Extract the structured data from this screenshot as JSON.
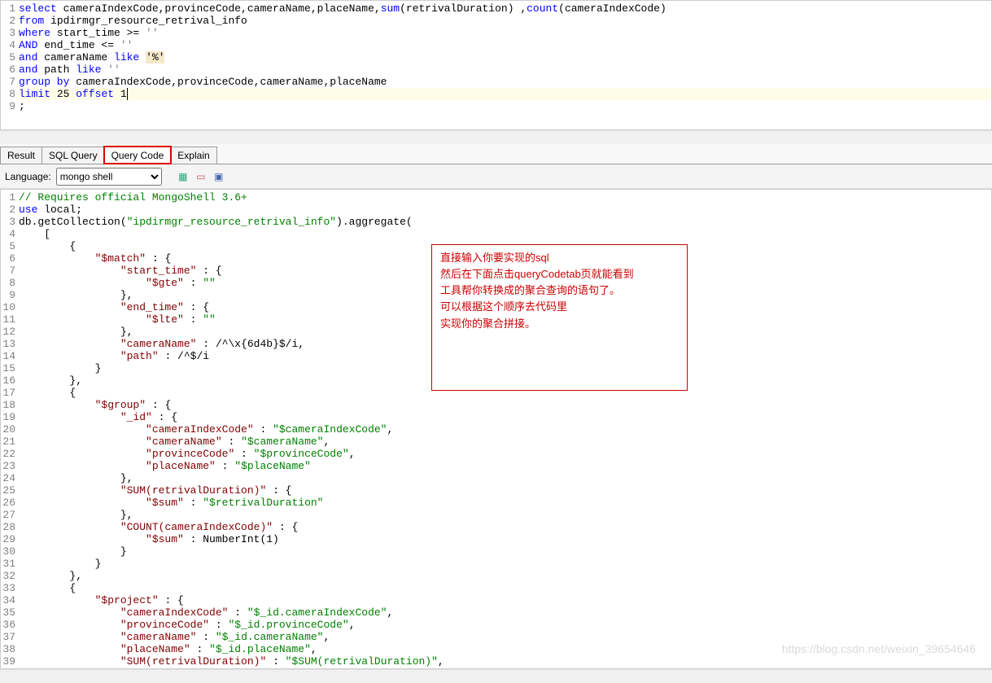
{
  "sql": {
    "lines": [
      {
        "n": 1,
        "h": false,
        "segs": [
          {
            "c": "kw",
            "t": "select"
          },
          {
            "c": "ident",
            "t": " cameraIndexCode,provinceCode,cameraName,placeName,"
          },
          {
            "c": "kw",
            "t": "sum"
          },
          {
            "c": "ident",
            "t": "(retrivalDuration) ,"
          },
          {
            "c": "kw",
            "t": "count"
          },
          {
            "c": "ident",
            "t": "(cameraIndexCode)"
          }
        ]
      },
      {
        "n": 2,
        "h": false,
        "segs": [
          {
            "c": "kw",
            "t": "from"
          },
          {
            "c": "ident",
            "t": " ipdirmgr_resource_retrival_info"
          }
        ]
      },
      {
        "n": 3,
        "h": false,
        "segs": [
          {
            "c": "kw",
            "t": "where"
          },
          {
            "c": "ident",
            "t": " start_time >= "
          },
          {
            "c": "str",
            "t": "''"
          }
        ]
      },
      {
        "n": 4,
        "h": false,
        "segs": [
          {
            "c": "kw",
            "t": "AND"
          },
          {
            "c": "ident",
            "t": " end_time <= "
          },
          {
            "c": "str",
            "t": "''"
          }
        ]
      },
      {
        "n": 5,
        "h": false,
        "segs": [
          {
            "c": "kw",
            "t": "and"
          },
          {
            "c": "ident",
            "t": " cameraName "
          },
          {
            "c": "kw",
            "t": "like"
          },
          {
            "c": "ident",
            "t": " "
          },
          {
            "c": "hstr",
            "t": "'%'"
          }
        ]
      },
      {
        "n": 6,
        "h": false,
        "segs": [
          {
            "c": "kw",
            "t": "and"
          },
          {
            "c": "ident",
            "t": " path "
          },
          {
            "c": "kw",
            "t": "like"
          },
          {
            "c": "ident",
            "t": " "
          },
          {
            "c": "str",
            "t": "''"
          }
        ]
      },
      {
        "n": 7,
        "h": false,
        "segs": [
          {
            "c": "kw",
            "t": "group by"
          },
          {
            "c": "ident",
            "t": " cameraIndexCode,provinceCode,cameraName,placeName"
          }
        ]
      },
      {
        "n": 8,
        "h": true,
        "segs": [
          {
            "c": "kw",
            "t": "limit"
          },
          {
            "c": "ident",
            "t": " 25 "
          },
          {
            "c": "kw",
            "t": "offset"
          },
          {
            "c": "ident",
            "t": " 1"
          },
          {
            "c": "cursor",
            "t": ""
          }
        ]
      },
      {
        "n": 9,
        "h": false,
        "segs": [
          {
            "c": "ident",
            "t": ";"
          }
        ]
      }
    ]
  },
  "tabs": [
    {
      "id": "result",
      "label": "Result",
      "active": false
    },
    {
      "id": "sqlquery",
      "label": "SQL Query",
      "active": false
    },
    {
      "id": "querycode",
      "label": "Query Code",
      "active": true
    },
    {
      "id": "explain",
      "label": "Explain",
      "active": false
    }
  ],
  "toolbar": {
    "language_label": "Language:",
    "language_value": "mongo shell",
    "icons": [
      "sheet",
      "grid",
      "blocks"
    ]
  },
  "mongo": {
    "lines": [
      {
        "n": 1,
        "segs": [
          {
            "c": "comment",
            "t": "// Requires official MongoShell 3.6+"
          }
        ]
      },
      {
        "n": 2,
        "segs": [
          {
            "c": "kw",
            "t": "use"
          },
          {
            "c": "ident",
            "t": " local;"
          }
        ]
      },
      {
        "n": 3,
        "segs": [
          {
            "c": "ident",
            "t": "db.getCollection("
          },
          {
            "c": "val-str",
            "t": "\"ipdirmgr_resource_retrival_info\""
          },
          {
            "c": "ident",
            "t": ").aggregate("
          }
        ]
      },
      {
        "n": 4,
        "segs": [
          {
            "c": "ident",
            "t": "    ["
          }
        ]
      },
      {
        "n": 5,
        "segs": [
          {
            "c": "ident",
            "t": "        {"
          }
        ]
      },
      {
        "n": 6,
        "segs": [
          {
            "c": "ident",
            "t": "            "
          },
          {
            "c": "prop",
            "t": "\"$match\""
          },
          {
            "c": "ident",
            "t": " : {"
          }
        ]
      },
      {
        "n": 7,
        "segs": [
          {
            "c": "ident",
            "t": "                "
          },
          {
            "c": "prop",
            "t": "\"start_time\""
          },
          {
            "c": "ident",
            "t": " : {"
          }
        ]
      },
      {
        "n": 8,
        "segs": [
          {
            "c": "ident",
            "t": "                    "
          },
          {
            "c": "prop",
            "t": "\"$gte\""
          },
          {
            "c": "ident",
            "t": " : "
          },
          {
            "c": "val-str",
            "t": "\"\""
          }
        ]
      },
      {
        "n": 9,
        "segs": [
          {
            "c": "ident",
            "t": "                },"
          }
        ]
      },
      {
        "n": 10,
        "segs": [
          {
            "c": "ident",
            "t": "                "
          },
          {
            "c": "prop",
            "t": "\"end_time\""
          },
          {
            "c": "ident",
            "t": " : {"
          }
        ]
      },
      {
        "n": 11,
        "segs": [
          {
            "c": "ident",
            "t": "                    "
          },
          {
            "c": "prop",
            "t": "\"$lte\""
          },
          {
            "c": "ident",
            "t": " : "
          },
          {
            "c": "val-str",
            "t": "\"\""
          }
        ]
      },
      {
        "n": 12,
        "segs": [
          {
            "c": "ident",
            "t": "                },"
          }
        ]
      },
      {
        "n": 13,
        "segs": [
          {
            "c": "ident",
            "t": "                "
          },
          {
            "c": "prop",
            "t": "\"cameraName\""
          },
          {
            "c": "ident",
            "t": " : /^\\x{6d4b}$/i,"
          }
        ]
      },
      {
        "n": 14,
        "segs": [
          {
            "c": "ident",
            "t": "                "
          },
          {
            "c": "prop",
            "t": "\"path\""
          },
          {
            "c": "ident",
            "t": " : /^$/i"
          }
        ]
      },
      {
        "n": 15,
        "segs": [
          {
            "c": "ident",
            "t": "            }"
          }
        ]
      },
      {
        "n": 16,
        "segs": [
          {
            "c": "ident",
            "t": "        },"
          }
        ]
      },
      {
        "n": 17,
        "segs": [
          {
            "c": "ident",
            "t": "        {"
          }
        ]
      },
      {
        "n": 18,
        "segs": [
          {
            "c": "ident",
            "t": "            "
          },
          {
            "c": "prop",
            "t": "\"$group\""
          },
          {
            "c": "ident",
            "t": " : {"
          }
        ]
      },
      {
        "n": 19,
        "segs": [
          {
            "c": "ident",
            "t": "                "
          },
          {
            "c": "prop",
            "t": "\"_id\""
          },
          {
            "c": "ident",
            "t": " : {"
          }
        ]
      },
      {
        "n": 20,
        "segs": [
          {
            "c": "ident",
            "t": "                    "
          },
          {
            "c": "prop",
            "t": "\"cameraIndexCode\""
          },
          {
            "c": "ident",
            "t": " : "
          },
          {
            "c": "val-str",
            "t": "\"$cameraIndexCode\""
          },
          {
            "c": "ident",
            "t": ","
          }
        ]
      },
      {
        "n": 21,
        "segs": [
          {
            "c": "ident",
            "t": "                    "
          },
          {
            "c": "prop",
            "t": "\"cameraName\""
          },
          {
            "c": "ident",
            "t": " : "
          },
          {
            "c": "val-str",
            "t": "\"$cameraName\""
          },
          {
            "c": "ident",
            "t": ","
          }
        ]
      },
      {
        "n": 22,
        "segs": [
          {
            "c": "ident",
            "t": "                    "
          },
          {
            "c": "prop",
            "t": "\"provinceCode\""
          },
          {
            "c": "ident",
            "t": " : "
          },
          {
            "c": "val-str",
            "t": "\"$provinceCode\""
          },
          {
            "c": "ident",
            "t": ","
          }
        ]
      },
      {
        "n": 23,
        "segs": [
          {
            "c": "ident",
            "t": "                    "
          },
          {
            "c": "prop",
            "t": "\"placeName\""
          },
          {
            "c": "ident",
            "t": " : "
          },
          {
            "c": "val-str",
            "t": "\"$placeName\""
          }
        ]
      },
      {
        "n": 24,
        "segs": [
          {
            "c": "ident",
            "t": "                },"
          }
        ]
      },
      {
        "n": 25,
        "segs": [
          {
            "c": "ident",
            "t": "                "
          },
          {
            "c": "prop",
            "t": "\"SUM(retrivalDuration)\""
          },
          {
            "c": "ident",
            "t": " : {"
          }
        ]
      },
      {
        "n": 26,
        "segs": [
          {
            "c": "ident",
            "t": "                    "
          },
          {
            "c": "prop",
            "t": "\"$sum\""
          },
          {
            "c": "ident",
            "t": " : "
          },
          {
            "c": "val-str",
            "t": "\"$retrivalDuration\""
          }
        ]
      },
      {
        "n": 27,
        "segs": [
          {
            "c": "ident",
            "t": "                },"
          }
        ]
      },
      {
        "n": 28,
        "segs": [
          {
            "c": "ident",
            "t": "                "
          },
          {
            "c": "prop",
            "t": "\"COUNT(cameraIndexCode)\""
          },
          {
            "c": "ident",
            "t": " : {"
          }
        ]
      },
      {
        "n": 29,
        "segs": [
          {
            "c": "ident",
            "t": "                    "
          },
          {
            "c": "prop",
            "t": "\"$sum\""
          },
          {
            "c": "ident",
            "t": " : NumberInt(1)"
          }
        ]
      },
      {
        "n": 30,
        "segs": [
          {
            "c": "ident",
            "t": "                }"
          }
        ]
      },
      {
        "n": 31,
        "segs": [
          {
            "c": "ident",
            "t": "            }"
          }
        ]
      },
      {
        "n": 32,
        "segs": [
          {
            "c": "ident",
            "t": "        },"
          }
        ]
      },
      {
        "n": 33,
        "segs": [
          {
            "c": "ident",
            "t": "        {"
          }
        ]
      },
      {
        "n": 34,
        "segs": [
          {
            "c": "ident",
            "t": "            "
          },
          {
            "c": "prop",
            "t": "\"$project\""
          },
          {
            "c": "ident",
            "t": " : {"
          }
        ]
      },
      {
        "n": 35,
        "segs": [
          {
            "c": "ident",
            "t": "                "
          },
          {
            "c": "prop",
            "t": "\"cameraIndexCode\""
          },
          {
            "c": "ident",
            "t": " : "
          },
          {
            "c": "val-str",
            "t": "\"$_id.cameraIndexCode\""
          },
          {
            "c": "ident",
            "t": ","
          }
        ]
      },
      {
        "n": 36,
        "segs": [
          {
            "c": "ident",
            "t": "                "
          },
          {
            "c": "prop",
            "t": "\"provinceCode\""
          },
          {
            "c": "ident",
            "t": " : "
          },
          {
            "c": "val-str",
            "t": "\"$_id.provinceCode\""
          },
          {
            "c": "ident",
            "t": ","
          }
        ]
      },
      {
        "n": 37,
        "segs": [
          {
            "c": "ident",
            "t": "                "
          },
          {
            "c": "prop",
            "t": "\"cameraName\""
          },
          {
            "c": "ident",
            "t": " : "
          },
          {
            "c": "val-str",
            "t": "\"$_id.cameraName\""
          },
          {
            "c": "ident",
            "t": ","
          }
        ]
      },
      {
        "n": 38,
        "segs": [
          {
            "c": "ident",
            "t": "                "
          },
          {
            "c": "prop",
            "t": "\"placeName\""
          },
          {
            "c": "ident",
            "t": " : "
          },
          {
            "c": "val-str",
            "t": "\"$_id.placeName\""
          },
          {
            "c": "ident",
            "t": ","
          }
        ]
      },
      {
        "n": 39,
        "segs": [
          {
            "c": "ident",
            "t": "                "
          },
          {
            "c": "prop",
            "t": "\"SUM(retrivalDuration)\""
          },
          {
            "c": "ident",
            "t": " : "
          },
          {
            "c": "val-str",
            "t": "\"$SUM(retrivalDuration)\""
          },
          {
            "c": "ident",
            "t": ","
          }
        ]
      }
    ]
  },
  "annotation": {
    "lines": [
      "直接输入你要实现的sql",
      "然后在下面点击queryCodetab页就能看到",
      "工具帮你转换成的聚合查询的语句了。",
      "可以根据这个顺序去代码里",
      "实现你的聚合拼接。"
    ]
  },
  "watermark": "https://blog.csdn.net/weixin_39654646"
}
